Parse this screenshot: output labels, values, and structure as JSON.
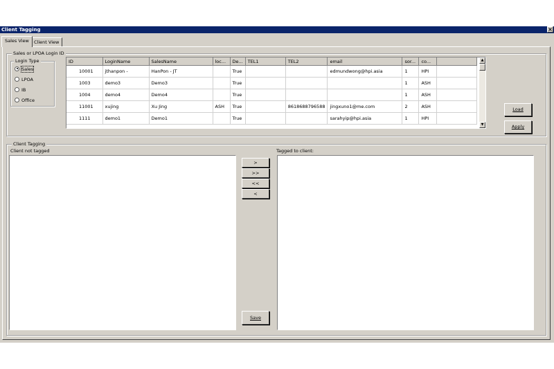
{
  "window": {
    "title": "Client Tagging",
    "close_glyph": "×"
  },
  "tabs": [
    {
      "label": "Sales View",
      "active": true
    },
    {
      "label": "Client View",
      "active": false
    }
  ],
  "sales_group": {
    "legend": "Sales or LPOA Login ID",
    "login_type": {
      "legend": "Login Type",
      "options": [
        {
          "label": "Sales",
          "checked": true
        },
        {
          "label": "LPOA",
          "checked": false
        },
        {
          "label": "IB",
          "checked": false
        },
        {
          "label": "Office",
          "checked": false
        }
      ]
    },
    "grid": {
      "columns": [
        "ID",
        "LoginName",
        "SalesName",
        "loc...",
        "De...",
        "TEL1",
        "TEL2",
        "email",
        "sor...",
        "co..."
      ],
      "rows": [
        [
          "10001",
          "jthanpon -",
          "HanPon -  JT",
          "",
          "True",
          "",
          "",
          "edmundwong@hpi.asia",
          "1",
          "HPI"
        ],
        [
          "1003",
          "demo3",
          "Demo3",
          "",
          "True",
          "",
          "",
          "",
          "1",
          "ASH"
        ],
        [
          "1004",
          "demo4",
          "Demo4",
          "",
          "True",
          "",
          "",
          "",
          "1",
          "ASH"
        ],
        [
          "11001",
          "xujing",
          "Xu Jing",
          "ASH",
          "True",
          "",
          "8618688796588",
          "jingxuno1@me.com",
          "2",
          "ASH"
        ],
        [
          "1111",
          "demo1",
          "Demo1",
          "",
          "True",
          "",
          "",
          "sarahyip@hpi.asia",
          "1",
          "HPI"
        ]
      ]
    },
    "load_label": "Load",
    "apply_label": "Apply"
  },
  "tagging_group": {
    "legend": "Client Tagging",
    "not_tagged_label": "Client not tagged",
    "tagged_label": "Tagged to client:",
    "buttons": {
      "add": ">",
      "add_all": ">>",
      "remove_all": "<<",
      "remove": "<"
    },
    "save_label": "Save"
  }
}
